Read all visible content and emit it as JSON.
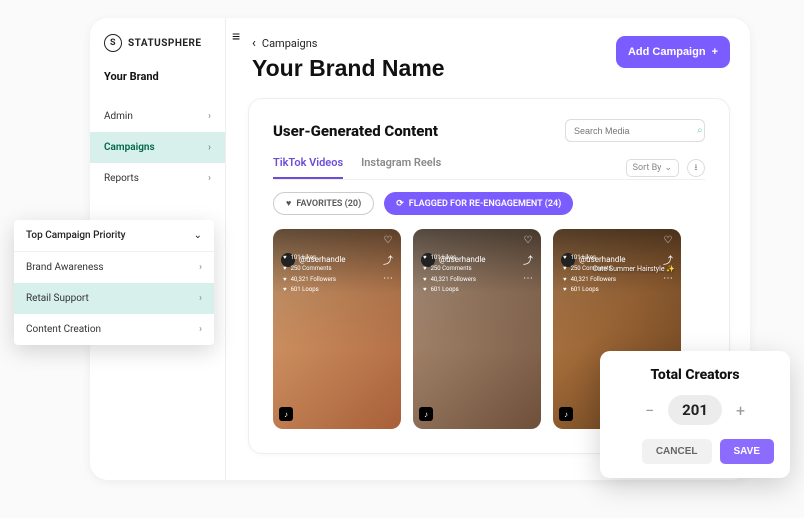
{
  "brand_logo_text": "STATUSPHERE",
  "brand_logo_letter": "S",
  "sidebar": {
    "your_brand": "Your Brand",
    "items": [
      {
        "label": "Admin"
      },
      {
        "label": "Campaigns"
      },
      {
        "label": "Reports"
      }
    ]
  },
  "header": {
    "crumb": "Campaigns",
    "page_title": "Your Brand Name",
    "add_btn": "Add Campaign"
  },
  "panel": {
    "title": "User-Generated Content",
    "search_placeholder": "Search Media",
    "tabs": {
      "tiktok": "TikTok Videos",
      "instagram": "Instagram Reels"
    },
    "sort_label": "Sort By",
    "pills": {
      "favorites": "FAVORITES (20)",
      "flagged": "FLAGGED FOR RE-ENGAGEMENT (24)"
    }
  },
  "cards": [
    {
      "handle": "@userhandle",
      "stats": [
        "101 Likes",
        "250 Comments",
        "40,321 Followers",
        "601 Loops"
      ],
      "label": ""
    },
    {
      "handle": "@userhandle",
      "stats": [
        "101 Likes",
        "250 Comments",
        "40,321 Followers",
        "601 Loops"
      ],
      "label": ""
    },
    {
      "handle": "@userhandle",
      "stats": [
        "101 Likes",
        "250 Comments",
        "40,321 Followers",
        "601 Loops"
      ],
      "label": "Cute Summer Hairstyle ✨"
    }
  ],
  "priority": {
    "head": "Top Campaign Priority",
    "items": [
      {
        "label": "Brand Awareness"
      },
      {
        "label": "Retail Support"
      },
      {
        "label": "Content Creation"
      }
    ]
  },
  "creators": {
    "title": "Total Creators",
    "value": "201",
    "cancel": "CANCEL",
    "save": "SAVE"
  }
}
